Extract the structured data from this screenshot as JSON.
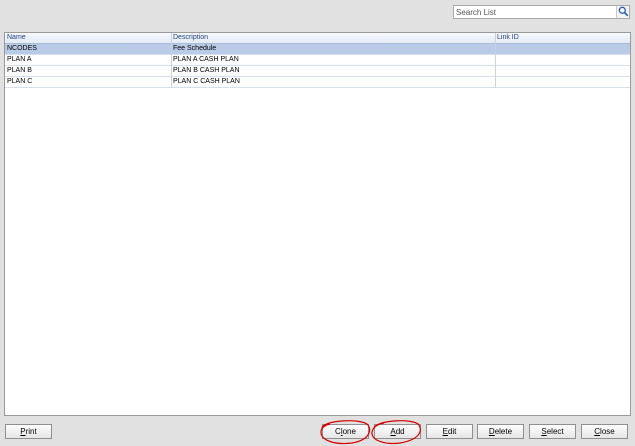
{
  "search": {
    "placeholder": "Search List",
    "icon": "magnifier-icon"
  },
  "grid": {
    "columns": [
      "Name",
      "Description",
      "Link ID"
    ],
    "rows": [
      {
        "name": "NCODES",
        "description": "Fee Schedule",
        "link_id": "",
        "selected": true
      },
      {
        "name": "PLAN A",
        "description": "PLAN A CASH PLAN",
        "link_id": "",
        "selected": false
      },
      {
        "name": "PLAN B",
        "description": "PLAN B CASH PLAN",
        "link_id": "",
        "selected": false
      },
      {
        "name": "PLAN C",
        "description": "PLAN C CASH PLAN",
        "link_id": "",
        "selected": false
      }
    ]
  },
  "buttons": {
    "print": {
      "access_key": "P",
      "rest": "rint"
    },
    "clone": {
      "before": "C",
      "access_key": "l",
      "rest": "one"
    },
    "add": {
      "access_key": "A",
      "rest": "dd"
    },
    "edit": {
      "access_key": "E",
      "rest": "dit"
    },
    "delete": {
      "access_key": "D",
      "rest": "elete"
    },
    "select": {
      "access_key": "S",
      "rest": "elect"
    },
    "close": {
      "access_key": "C",
      "rest": "lose"
    }
  },
  "colors": {
    "annotation": "#d40000",
    "selected_row": "#b9cbe6",
    "header_text": "#1f3f7f"
  }
}
